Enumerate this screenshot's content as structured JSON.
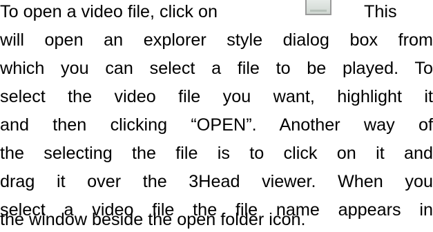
{
  "paragraph": {
    "line0_lead": "To open a video file, click on",
    "line0_tail": "This",
    "lines": [
      "will open an explorer style dialog box from",
      "which you can select a file to be played. To",
      "select the video file you want, highlight it",
      "and then clicking “OPEN”. Another way of",
      "the selecting the file is to click on it and",
      "drag it over the 3Head viewer. When you",
      "select a video file the file name appears in",
      "the window beside the open folder icon."
    ]
  },
  "inline_icon": {
    "name": "open-folder-icon",
    "colors": {
      "fill_top": "#e6ebe8",
      "fill_bottom": "#cfd6d1",
      "border": "#9a9a9a"
    }
  }
}
